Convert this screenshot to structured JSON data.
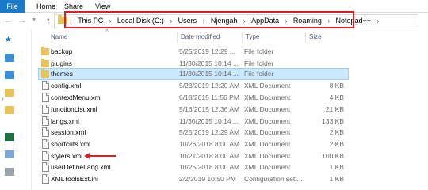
{
  "ribbon": {
    "tabs": [
      {
        "label": "File"
      },
      {
        "label": "Home"
      },
      {
        "label": "Share"
      },
      {
        "label": "View"
      }
    ]
  },
  "address": {
    "crumbs": [
      "This PC",
      "Local Disk (C:)",
      "Users",
      "Njengah",
      "AppData",
      "Roaming",
      "Notepad++"
    ],
    "highlight_color": "#e31b23"
  },
  "columns": {
    "name": "Name",
    "date": "Date modified",
    "type": "Type",
    "size": "Size"
  },
  "files": [
    {
      "name": "backup",
      "date": "5/25/2019 12:29 ...",
      "type": "File folder",
      "size": "",
      "kind": "folder-icon"
    },
    {
      "name": "plugins",
      "date": "11/30/2015 10:14 ...",
      "type": "File folder",
      "size": "",
      "kind": "folder-icon"
    },
    {
      "name": "themes",
      "date": "11/30/2015 10:14 ...",
      "type": "File folder",
      "size": "",
      "kind": "folder-icon",
      "selected": true
    },
    {
      "name": "config.xml",
      "date": "5/23/2019 12:20 AM",
      "type": "XML Document",
      "size": "8 KB",
      "kind": "xml-file-icon"
    },
    {
      "name": "contextMenu.xml",
      "date": "6/18/2015 11:56 PM",
      "type": "XML Document",
      "size": "4 KB",
      "kind": "xml-file-icon"
    },
    {
      "name": "functionList.xml",
      "date": "5/16/2015 12:36 AM",
      "type": "XML Document",
      "size": "21 KB",
      "kind": "xml-file-icon"
    },
    {
      "name": "langs.xml",
      "date": "11/30/2015 10:14 ...",
      "type": "XML Document",
      "size": "133 KB",
      "kind": "xml-file-icon"
    },
    {
      "name": "session.xml",
      "date": "5/25/2019 12:29 AM",
      "type": "XML Document",
      "size": "2 KB",
      "kind": "xml-file-icon"
    },
    {
      "name": "shortcuts.xml",
      "date": "10/26/2018 8:00 AM",
      "type": "XML Document",
      "size": "2 KB",
      "kind": "xml-file-icon"
    },
    {
      "name": "stylers.xml",
      "date": "10/21/2018 8:00 AM",
      "type": "XML Document",
      "size": "100 KB",
      "kind": "xml-file-icon"
    },
    {
      "name": "userDefineLang.xml",
      "date": "10/25/2018 8:00 AM",
      "type": "XML Document",
      "size": "1 KB",
      "kind": "xml-file-icon"
    },
    {
      "name": "XMLToolsExt.ini",
      "date": "2/2/2019 10:50 PM",
      "type": "Configuration sett...",
      "size": "1 KB",
      "kind": "ini-file-icon"
    }
  ],
  "colors": {
    "selection": "#cce8ff",
    "file_tab": "#1979ca",
    "annotation_arrow": "#d3242a"
  }
}
